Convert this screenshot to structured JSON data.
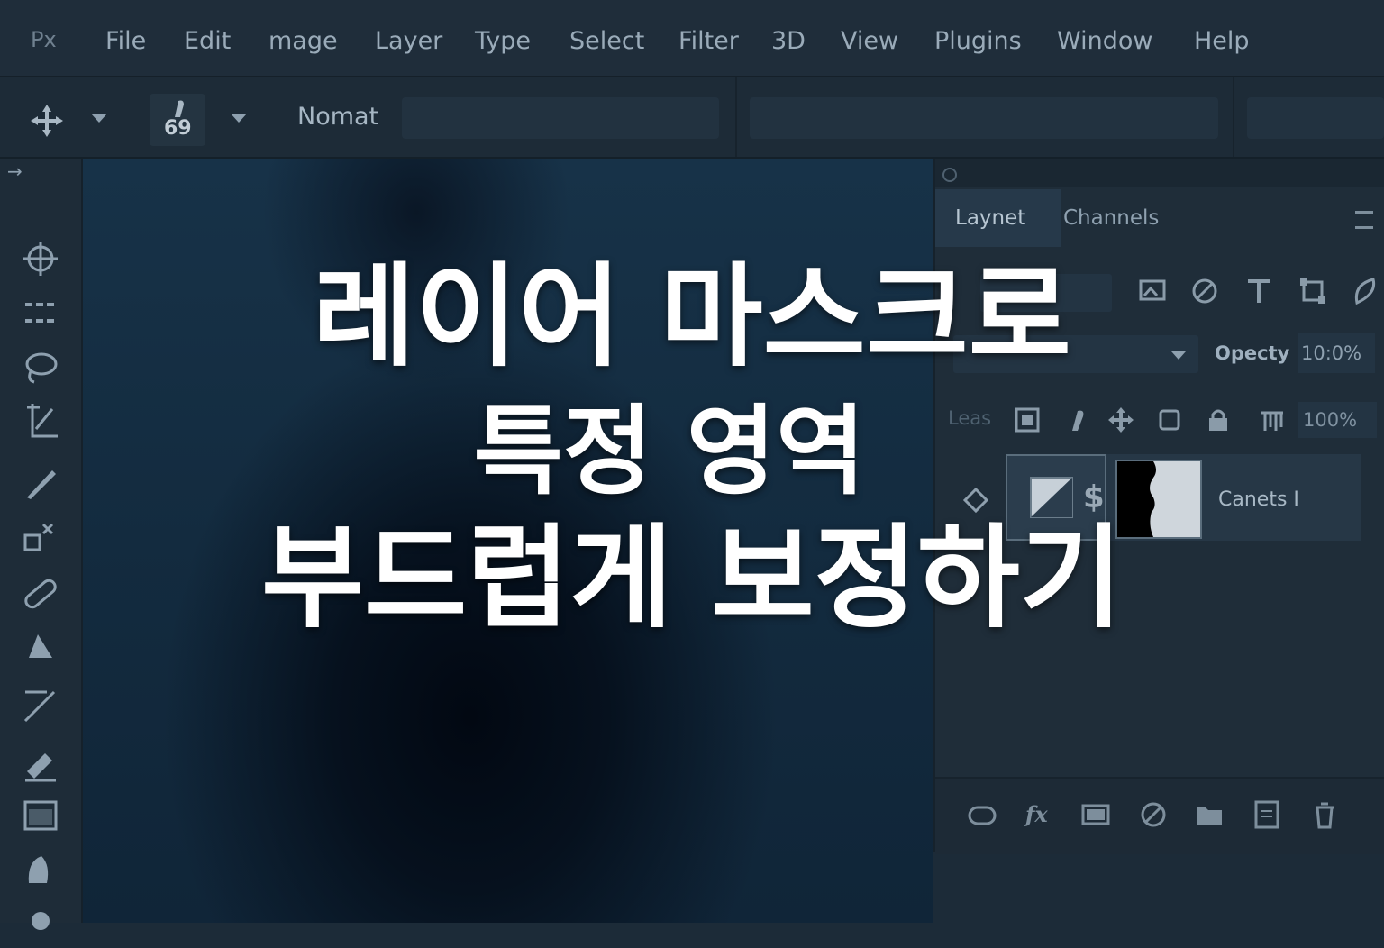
{
  "app": {
    "logo": "Px"
  },
  "menu": [
    "File",
    "Edit",
    "mage",
    "Layer",
    "Type",
    "Select",
    "Filter",
    "3D",
    "View",
    "Plugins",
    "Window",
    "Help"
  ],
  "options_bar": {
    "tool_icon": "move-icon",
    "brush_size": "69",
    "mode_label": "Nomat"
  },
  "toolbar": {
    "collapse_glyph": "→",
    "tools": [
      "crosshair-icon",
      "marquee-icon",
      "lasso-icon",
      "crop-icon",
      "brush-icon",
      "healing-icon",
      "bandage-icon",
      "paint-bucket-icon",
      "pen-icon",
      "eraser-icon",
      "gradient-icon",
      "dodge-icon",
      "smudge-icon"
    ]
  },
  "panel": {
    "tabs": [
      "Laynet",
      "Channels"
    ],
    "opacity_label": "Opecty",
    "opacity_value": "10:0%",
    "lock_label": "Leas",
    "fill_value": "100%",
    "layer_name": "Canets I",
    "layer_link_glyph": "$"
  },
  "headline": {
    "line1": "레이어 마스크로",
    "line2": "특정 영역",
    "line3": "부드럽게 보정하기"
  }
}
